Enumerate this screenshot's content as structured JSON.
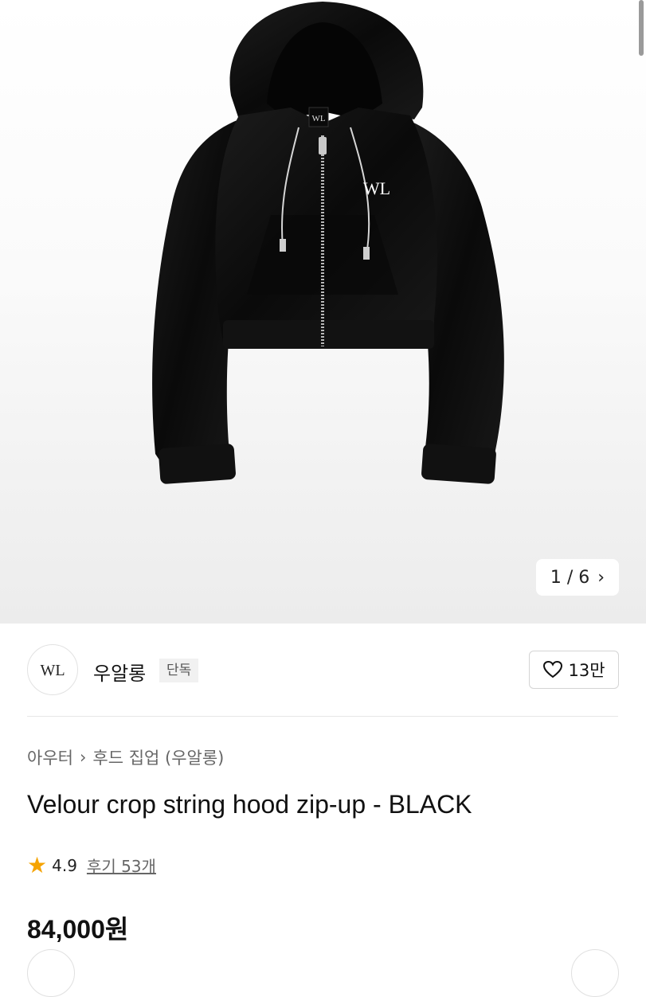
{
  "gallery": {
    "current": "1",
    "separator": "/",
    "total": "6",
    "next_arrow": "›",
    "logo_text": "WL"
  },
  "brand": {
    "name": "우알롱",
    "badge": "단독",
    "logo_text": "WL",
    "likes": "13만",
    "like_icon": "heart-outline-icon"
  },
  "breadcrumb": {
    "items": [
      "아우터",
      "후드 집업 (우알롱)"
    ],
    "separator": "›"
  },
  "product": {
    "title": "Velour crop string hood zip-up - BLACK",
    "rating": "4.9",
    "reviews": "후기 53개",
    "price": "84,000원"
  },
  "colors": {
    "star": "#f5a300",
    "garment": "#0f0f0f"
  }
}
